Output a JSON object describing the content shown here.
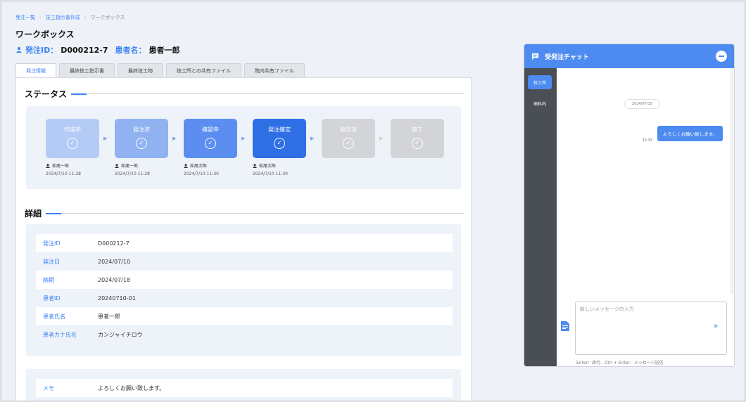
{
  "breadcrumb": {
    "items": [
      "発注一覧",
      "技工指示書作成",
      "ワークボックス"
    ]
  },
  "page": {
    "title": "ワークボックス"
  },
  "order": {
    "id_label": "発注ID：",
    "id_value": "D000212-7",
    "patient_label": "患者名：",
    "patient_value": "患者一郎"
  },
  "tabs": [
    "発注情報",
    "最終技工指示書",
    "最終技工物",
    "技工所との共有ファイル",
    "院内共有ファイル"
  ],
  "status": {
    "heading": "ステータス",
    "steps": [
      {
        "label": "作成中",
        "user": "松尾一郎",
        "time": "2024/7/10 11:28"
      },
      {
        "label": "発注済",
        "user": "松尾一郎",
        "time": "2024/7/10 11:28"
      },
      {
        "label": "確認中",
        "user": "松尾次郎",
        "time": "2024/7/10 11:30"
      },
      {
        "label": "発注確定",
        "user": "松尾次郎",
        "time": "2024/7/10 11:30"
      },
      {
        "label": "発送済",
        "user": "",
        "time": ""
      },
      {
        "label": "完了",
        "user": "",
        "time": ""
      }
    ]
  },
  "details": {
    "heading": "詳細",
    "rows": [
      {
        "key": "発注ID",
        "value": "D000212-7"
      },
      {
        "key": "発注日",
        "value": "2024/07/10"
      },
      {
        "key": "納期",
        "value": "2024/07/18"
      },
      {
        "key": "患者ID",
        "value": "20240710-01"
      },
      {
        "key": "患者氏名",
        "value": "患者一郎"
      },
      {
        "key": "患者カナ氏名",
        "value": "カンジャイチロウ"
      }
    ],
    "memo_key": "メモ",
    "memo_value": "よろしくお願い致します。"
  },
  "chat": {
    "title": "受発注チャット",
    "side_items": [
      "技工所",
      "歯科内"
    ],
    "date": "2024/07/10",
    "message": "よろしくお願い致します。",
    "message_time": "11:33",
    "input_placeholder": "新しいメッセージの入力",
    "hint": "Enter：改行、Ctrl + Enter：メッセージ送信"
  },
  "colors": {
    "accent": "#4d8bf0",
    "sidebar": "#4a4f56",
    "panel": "#eef3fa"
  }
}
